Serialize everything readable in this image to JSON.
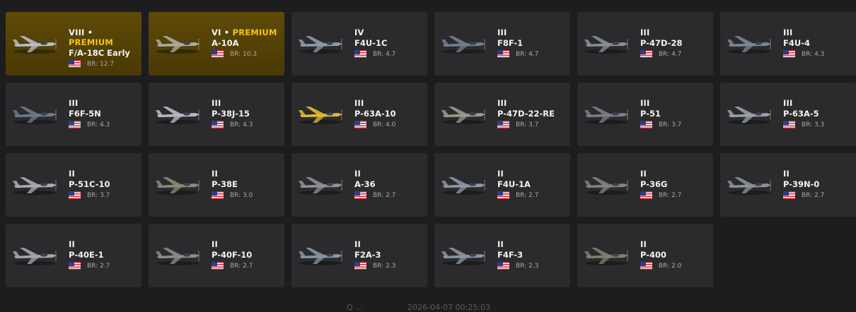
{
  "br_prefix": "BR:",
  "colors": {
    "premium_text": "#f5c518",
    "premium_bg": "#4f3d06",
    "card_bg": "#2b2b2d",
    "page_bg": "#1d1d1f"
  },
  "vehicles": [
    {
      "rank": "VIII •",
      "premium": "PREMIUM",
      "name": "F/A-18C Early",
      "br": "12.7",
      "country": "usa-flag-icon",
      "plane_color": "#b9bec4"
    },
    {
      "rank": "VI •",
      "premium": "PREMIUM",
      "name": "A-10A",
      "br": "10.3",
      "country": "usa-flag-icon",
      "plane_color": "#a9ad9f"
    },
    {
      "rank": "IV",
      "premium": "",
      "name": "F4U-1C",
      "br": "4.7",
      "country": "usa-flag-icon",
      "plane_color": "#8e9aa8"
    },
    {
      "rank": "III",
      "premium": "",
      "name": "F8F-1",
      "br": "4.7",
      "country": "usa-flag-icon",
      "plane_color": "#6f7f92"
    },
    {
      "rank": "III",
      "premium": "",
      "name": "P-47D-28",
      "br": "4.7",
      "country": "usa-flag-icon",
      "plane_color": "#8a8f97"
    },
    {
      "rank": "III",
      "premium": "",
      "name": "F4U-4",
      "br": "4.3",
      "country": "usa-flag-icon",
      "plane_color": "#7c8796"
    },
    {
      "rank": "III",
      "premium": "",
      "name": "F6F-5N",
      "br": "4.3",
      "country": "usa-flag-icon",
      "plane_color": "#6d7a8a"
    },
    {
      "rank": "III",
      "premium": "",
      "name": "P-38J-15",
      "br": "4.3",
      "country": "usa-flag-icon",
      "plane_color": "#b8bcc2"
    },
    {
      "rank": "III",
      "premium": "",
      "name": "P-63A-10",
      "br": "4.0",
      "country": "usa-flag-icon",
      "plane_color": "#e1b93a"
    },
    {
      "rank": "III",
      "premium": "",
      "name": "P-47D-22-RE",
      "br": "3.7",
      "country": "usa-flag-icon",
      "plane_color": "#9a9c90"
    },
    {
      "rank": "III",
      "premium": "",
      "name": "P-51",
      "br": "3.7",
      "country": "usa-flag-icon",
      "plane_color": "#7b7e86"
    },
    {
      "rank": "III",
      "premium": "",
      "name": "P-63A-5",
      "br": "3.3",
      "country": "usa-flag-icon",
      "plane_color": "#9aa1a8"
    },
    {
      "rank": "II",
      "premium": "",
      "name": "P-51C-10",
      "br": "3.7",
      "country": "usa-flag-icon",
      "plane_color": "#a9acb1"
    },
    {
      "rank": "II",
      "premium": "",
      "name": "P-38E",
      "br": "3.0",
      "country": "usa-flag-icon",
      "plane_color": "#8d8a78"
    },
    {
      "rank": "II",
      "premium": "",
      "name": "A-36",
      "br": "2.7",
      "country": "usa-flag-icon",
      "plane_color": "#8f9194"
    },
    {
      "rank": "II",
      "premium": "",
      "name": "F4U-1A",
      "br": "2.7",
      "country": "usa-flag-icon",
      "plane_color": "#8b98a6"
    },
    {
      "rank": "II",
      "premium": "",
      "name": "P-36G",
      "br": "2.7",
      "country": "usa-flag-icon",
      "plane_color": "#7f8580"
    },
    {
      "rank": "II",
      "premium": "",
      "name": "P-39N-0",
      "br": "2.7",
      "country": "usa-flag-icon",
      "plane_color": "#8d929a"
    },
    {
      "rank": "II",
      "premium": "",
      "name": "P-40E-1",
      "br": "2.7",
      "country": "usa-flag-icon",
      "plane_color": "#a4a7ab"
    },
    {
      "rank": "II",
      "premium": "",
      "name": "P-40F-10",
      "br": "2.7",
      "country": "usa-flag-icon",
      "plane_color": "#8a8d8c"
    },
    {
      "rank": "II",
      "premium": "",
      "name": "F2A-3",
      "br": "2.3",
      "country": "usa-flag-icon",
      "plane_color": "#8796a6"
    },
    {
      "rank": "II",
      "premium": "",
      "name": "F4F-3",
      "br": "2.3",
      "country": "usa-flag-icon",
      "plane_color": "#8a95a3"
    },
    {
      "rank": "II",
      "premium": "",
      "name": "P-400",
      "br": "2.0",
      "country": "usa-flag-icon",
      "plane_color": "#7d8270"
    }
  ],
  "footer": {
    "left_text": "Q ...",
    "timestamp": "2026-04-07 00:25:03"
  }
}
